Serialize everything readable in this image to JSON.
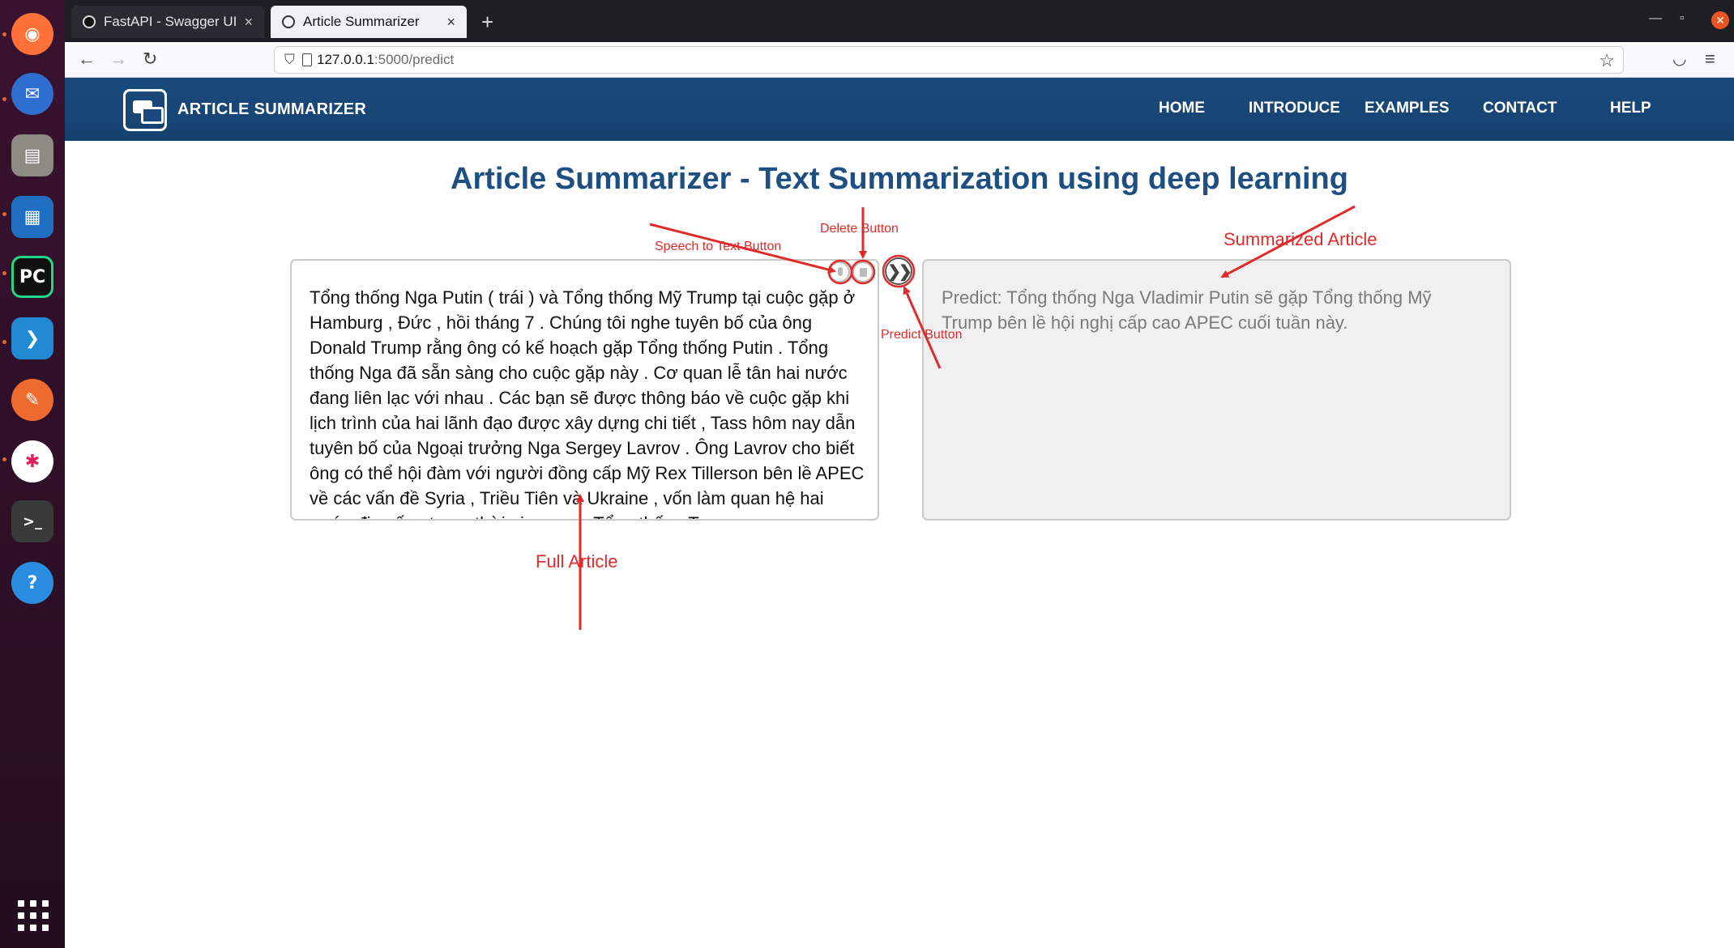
{
  "dock": {
    "apps": [
      {
        "icon": "firefox-icon",
        "color": "#ff7139",
        "glyph": "◉"
      },
      {
        "icon": "thunderbird-icon",
        "color": "#2f6fd1",
        "glyph": "✉"
      },
      {
        "icon": "files-icon",
        "color": "#8e8a84",
        "glyph": "▤"
      },
      {
        "icon": "writer-icon",
        "color": "#1e6fc2",
        "glyph": "▦"
      },
      {
        "icon": "pycharm-icon",
        "color": "#111111",
        "glyph": "PC"
      },
      {
        "icon": "vscode-icon",
        "color": "#1f8ad2",
        "glyph": "❯"
      },
      {
        "icon": "postman-icon",
        "color": "#ef6a2f",
        "glyph": "✎"
      },
      {
        "icon": "slack-icon",
        "color": "#ffffff",
        "glyph": "✱"
      },
      {
        "icon": "terminal-icon",
        "color": "#3a3a3a",
        "glyph": ">_"
      },
      {
        "icon": "help-icon",
        "color": "#2a8de0",
        "glyph": "?"
      }
    ]
  },
  "browser": {
    "tabs": [
      {
        "title": "FastAPI - Swagger UI"
      },
      {
        "title": "Article Summarizer"
      }
    ],
    "close_glyph": "×",
    "new_tab_glyph": "+",
    "url_host": "127.0.0.1",
    "url_path": ":5000/predict"
  },
  "site": {
    "brand": "ARTICLE SUMMARIZER",
    "nav": [
      "HOME",
      "INTRODUCE",
      "EXAMPLES",
      "CONTACT",
      "HELP"
    ],
    "title": "Article Summarizer - Text Summarization using deep learning"
  },
  "article": {
    "text": "Tổng thống Nga Putin ( trái ) và Tổng thống Mỹ Trump tại cuộc gặp ở Hamburg , Đức , hồi tháng 7 . Chúng tôi nghe tuyên bố của ông Donald Trump rằng ông có kế hoạch gặp Tổng thống Putin . Tổng thống Nga đã sẵn sàng cho cuộc gặp này . Cơ quan lễ tân hai nước đang liên lạc với nhau . Các bạn sẽ được thông báo về cuộc gặp khi lịch trình của hai lãnh đạo được xây dựng chi tiết , Tass hôm nay dẫn tuyên bố của Ngoại trưởng Nga Sergey Lavrov . Ông Lavrov cho biết ông có thể hội đàm với người đồng cấp Mỹ Rex Tillerson bên lề APEC về các vấn đề Syria , Triều Tiên và Ukraine , vốn làm quan hệ hai nước đi xuống trong thời gian qua . Tổng thống Trump"
  },
  "summary": {
    "text": "Predict: Tổng thống Nga Vladimir Putin sẽ gặp Tổng thống Mỹ Trump bên lề hội nghị cấp cao APEC cuối tuần này."
  },
  "annotations": {
    "speech": "Speech to Text Button",
    "delete": "Delete Button",
    "predict": "Predict Button",
    "summarized": "Summarized Article",
    "full": "Full Article",
    "color": "#e02b2b"
  },
  "colors": {
    "header": "#1a4a7d",
    "title": "#1d4f82"
  }
}
